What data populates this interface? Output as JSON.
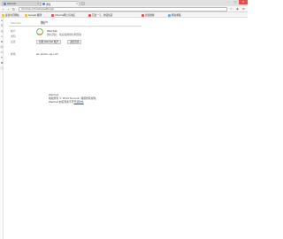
{
  "browser": {
    "tabs": [
      {
        "label": "WeChat"
      },
      {
        "label": "通知"
      }
    ],
    "window_controls": [
      "–",
      "□",
      "✕"
    ],
    "address": "chrome://chrome/settings/",
    "bookmarks": [
      {
        "label": "最常访问网站"
      },
      {
        "label": "Google 翻译"
      },
      {
        "label": "Chrome网上应用店"
      },
      {
        "label": "百度一下，你就知道"
      },
      {
        "label": "新浪微博"
      },
      {
        "label": "网易邮箱"
      }
    ]
  },
  "page": {
    "account_name": "WeChat",
    "tab_title": "帐户",
    "side_menu": [
      "帐户",
      "通知",
      "设置"
    ],
    "profile": {
      "name": "WeChat",
      "description": "微信团队，欢迎使用微信网页版"
    },
    "buttons": {
      "change_account": "切换 WeChat 帐户",
      "logout": "退出登录"
    },
    "email": {
      "label": "邮箱",
      "value": "wx.weixin.qq.com"
    },
    "footer": {
      "title": "WeChat",
      "line1": "版权所有 © 2014 Tencent. 保留所有权利。",
      "line2_prefix": "WeChat 的实现离不开",
      "line2_link": "开源软件"
    }
  },
  "colors": {
    "link": "#2a5db0",
    "close_button": "#d9534f",
    "logo_ring": "#6aa84f",
    "logo_accent": "#e69138"
  }
}
